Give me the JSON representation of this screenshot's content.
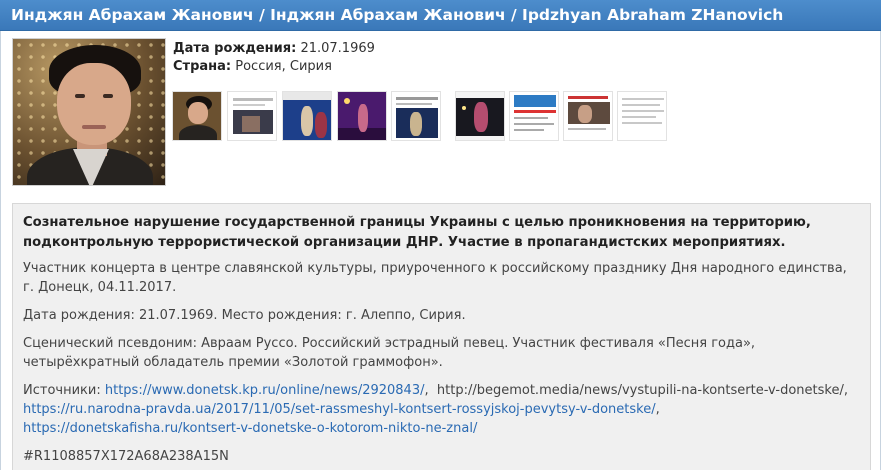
{
  "header": {
    "title": "Инджян Абрахам Жанович / Інджян Абрахам Жанович / Ipdzhyan Abraham ZHanovich"
  },
  "profile": {
    "birth_label": "Дата рождения:",
    "birth_value": "21.07.1969",
    "country_label": "Страна:",
    "country_value": "Россия, Сирия"
  },
  "thumbnails_count": 9,
  "description": {
    "title": "Сознательное нарушение государственной границы Украины с целью проникновения на территорию, подконтрольную террористической организации ДНР. Участие в пропагандистских мероприятиях.",
    "p1": "Участник концерта в центре славянской культуры, приуроченного к российскому празднику Дня народного единства, г. Донецк, 04.11.2017.",
    "p2": "Дата рождения: 21.07.1969. Место рождения: г. Алеппо, Сирия.",
    "p3": "Сценический псевдоним: Авраам Руссо. Российский эстрадный певец. Участник фестиваля «Песня года», четырёхкратный обладатель премии «Золотой граммофон».",
    "sources_label": "Источники:",
    "sources": [
      {
        "text": "https://www.donetsk.kp.ru/online/news/2920843/",
        "link": true
      },
      {
        "text": "http://begemot.media/news/vystupili-na-kontserte-v-donetske/",
        "link": false
      },
      {
        "text": "https://ru.narodna-pravda.ua/2017/11/05/set-rassmeshyl-kontsert-rossyjskoj-pevytsy-v-donetske/",
        "link": true
      },
      {
        "text": "https://donetskafisha.ru/kontsert-v-donetske-o-kotorom-nikto-ne-znal/",
        "link": true
      }
    ],
    "code": "#R1108857X172A68A238A15N"
  },
  "colors": {
    "header_bg": "#3f7fc0",
    "link": "#2a6ab3",
    "panel_bg": "#f0f0f0"
  }
}
